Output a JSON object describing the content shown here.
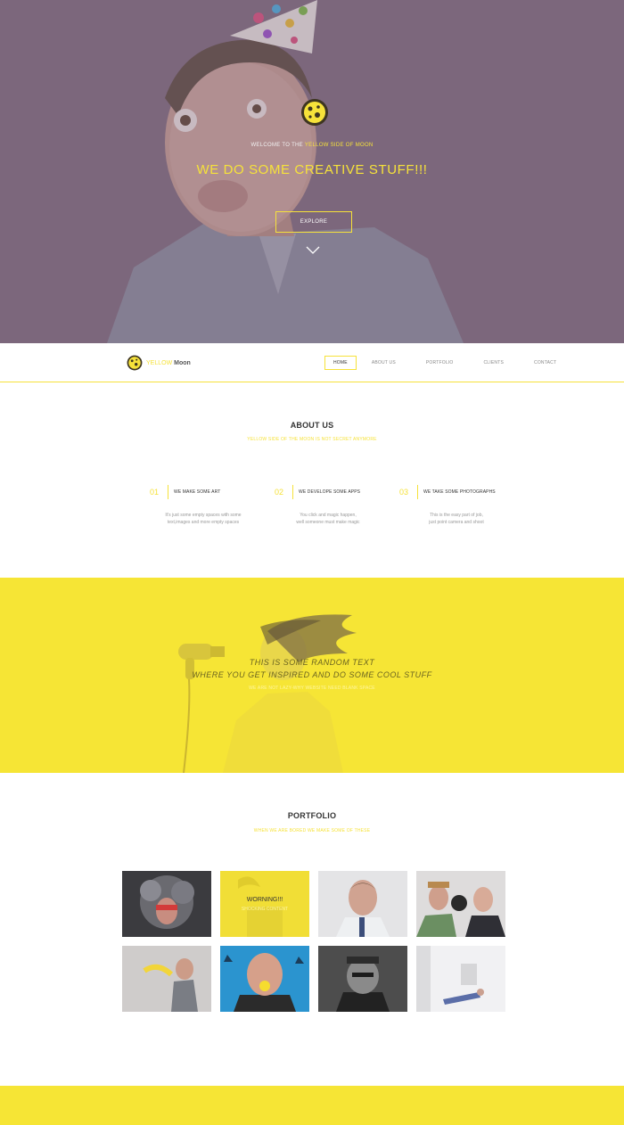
{
  "hero": {
    "kicker_prefix": "WELCOME TO THE",
    "kicker_highlight": "YELLOW SIDE OF MOON",
    "title": "WE DO SOME CREATIVE STUFF!!!",
    "button_label": "EXPLORE"
  },
  "brand": {
    "name_part1": "YELLOW",
    "name_part2": "Moon",
    "accent_color": "#f6e23a"
  },
  "nav": {
    "items": [
      {
        "label": "HOME",
        "active": true
      },
      {
        "label": "ABOUT US",
        "active": false
      },
      {
        "label": "PORTFOLIO",
        "active": false
      },
      {
        "label": "CLIENTS",
        "active": false
      },
      {
        "label": "CONTACT",
        "active": false
      }
    ]
  },
  "about": {
    "title": "ABOUT US",
    "subtitle": "YELLOW SIDE OF THE MOON IS NOT SECRET ANYMORE",
    "features": [
      {
        "num": "01",
        "title": "WE MAKE SOME ART",
        "desc": "It's just some empty spaces with some\ntext,images and more empty spaces"
      },
      {
        "num": "02",
        "title": "WE DEVELOPE SOME APPS",
        "desc": "You click and magic happen,\nwell someone must make magic"
      },
      {
        "num": "03",
        "title": "WE TAKE SOME PHOTOGRAPHS",
        "desc": "This is the easy part of job,\njust point camera and shoot"
      }
    ]
  },
  "band": {
    "line1": "THIS IS SOME RANDOM TEXT",
    "line2": "WHERE YOU GET INSPIRED AND DO SOME COOL STUFF",
    "sub": "WE ARE NOT LAZY-WHY WEBSITE NEED BLANK SPACE"
  },
  "portfolio": {
    "title": "PORTFOLIO",
    "subtitle": "WHEN WE ARE BORED WE MAKE SOME OF THESE",
    "hover_title": "WORNING!!!",
    "hover_sub": "SHOCKING CONTENT"
  }
}
